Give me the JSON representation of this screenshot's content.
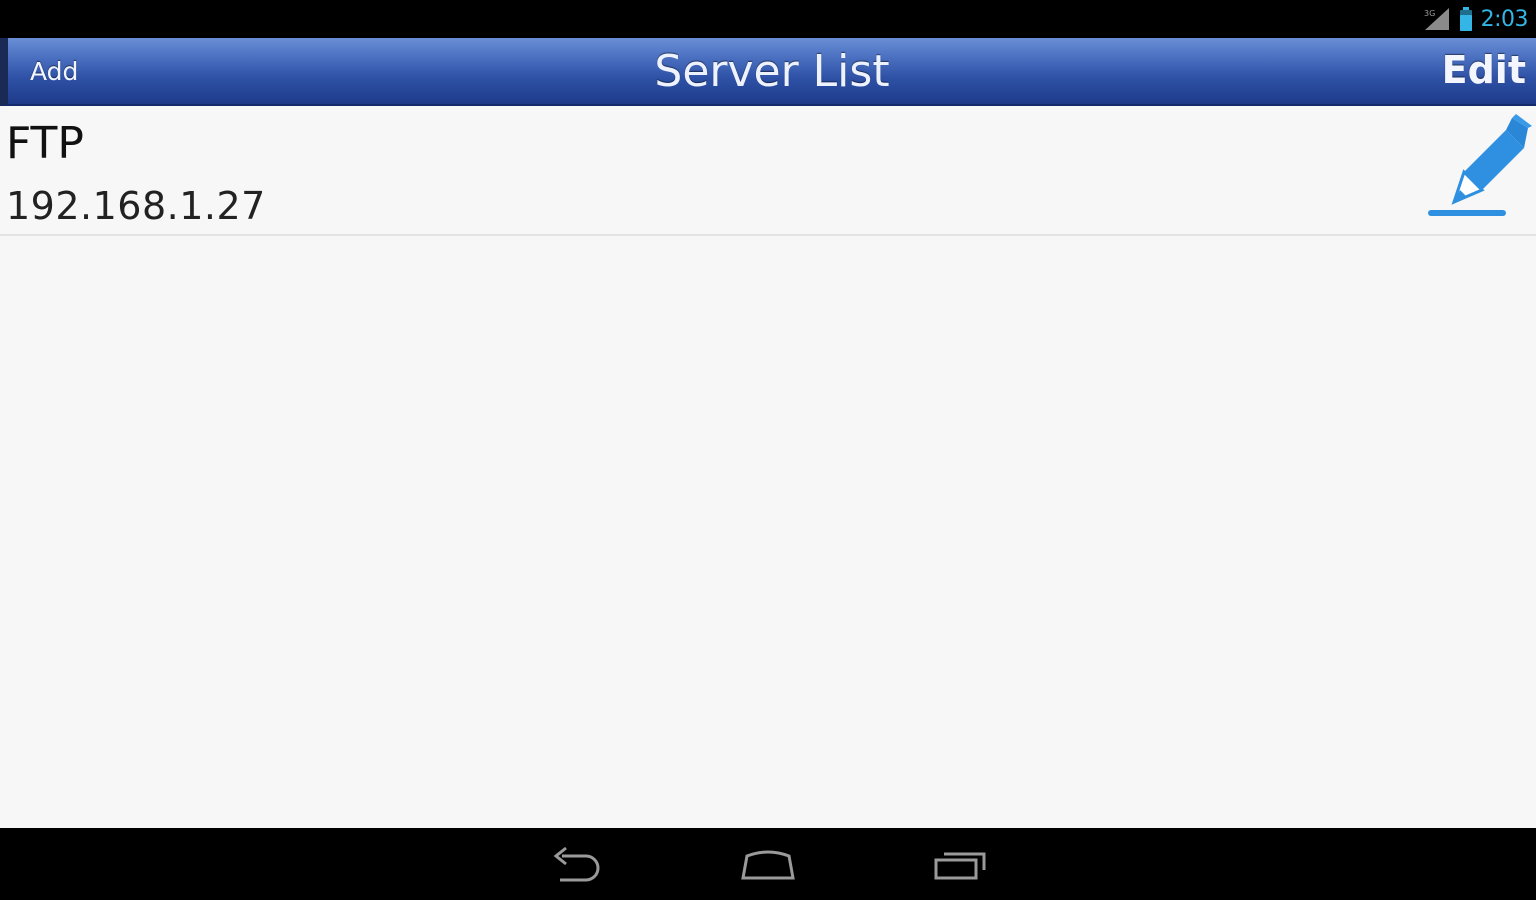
{
  "status_bar": {
    "time": "2:03",
    "icons": [
      "signal-icon",
      "battery-icon"
    ],
    "time_color": "#33b5e5"
  },
  "header": {
    "add_label": "Add",
    "title": "Server List",
    "edit_label": "Edit",
    "bar_color": "#2f52a6"
  },
  "servers": [
    {
      "name": "FTP",
      "address": "192.168.1.27",
      "action_icon": "pencil-icon",
      "accent_color": "#2f8fe0"
    }
  ],
  "nav_bar": {
    "buttons": [
      "back-icon",
      "home-icon",
      "recent-apps-icon"
    ]
  }
}
